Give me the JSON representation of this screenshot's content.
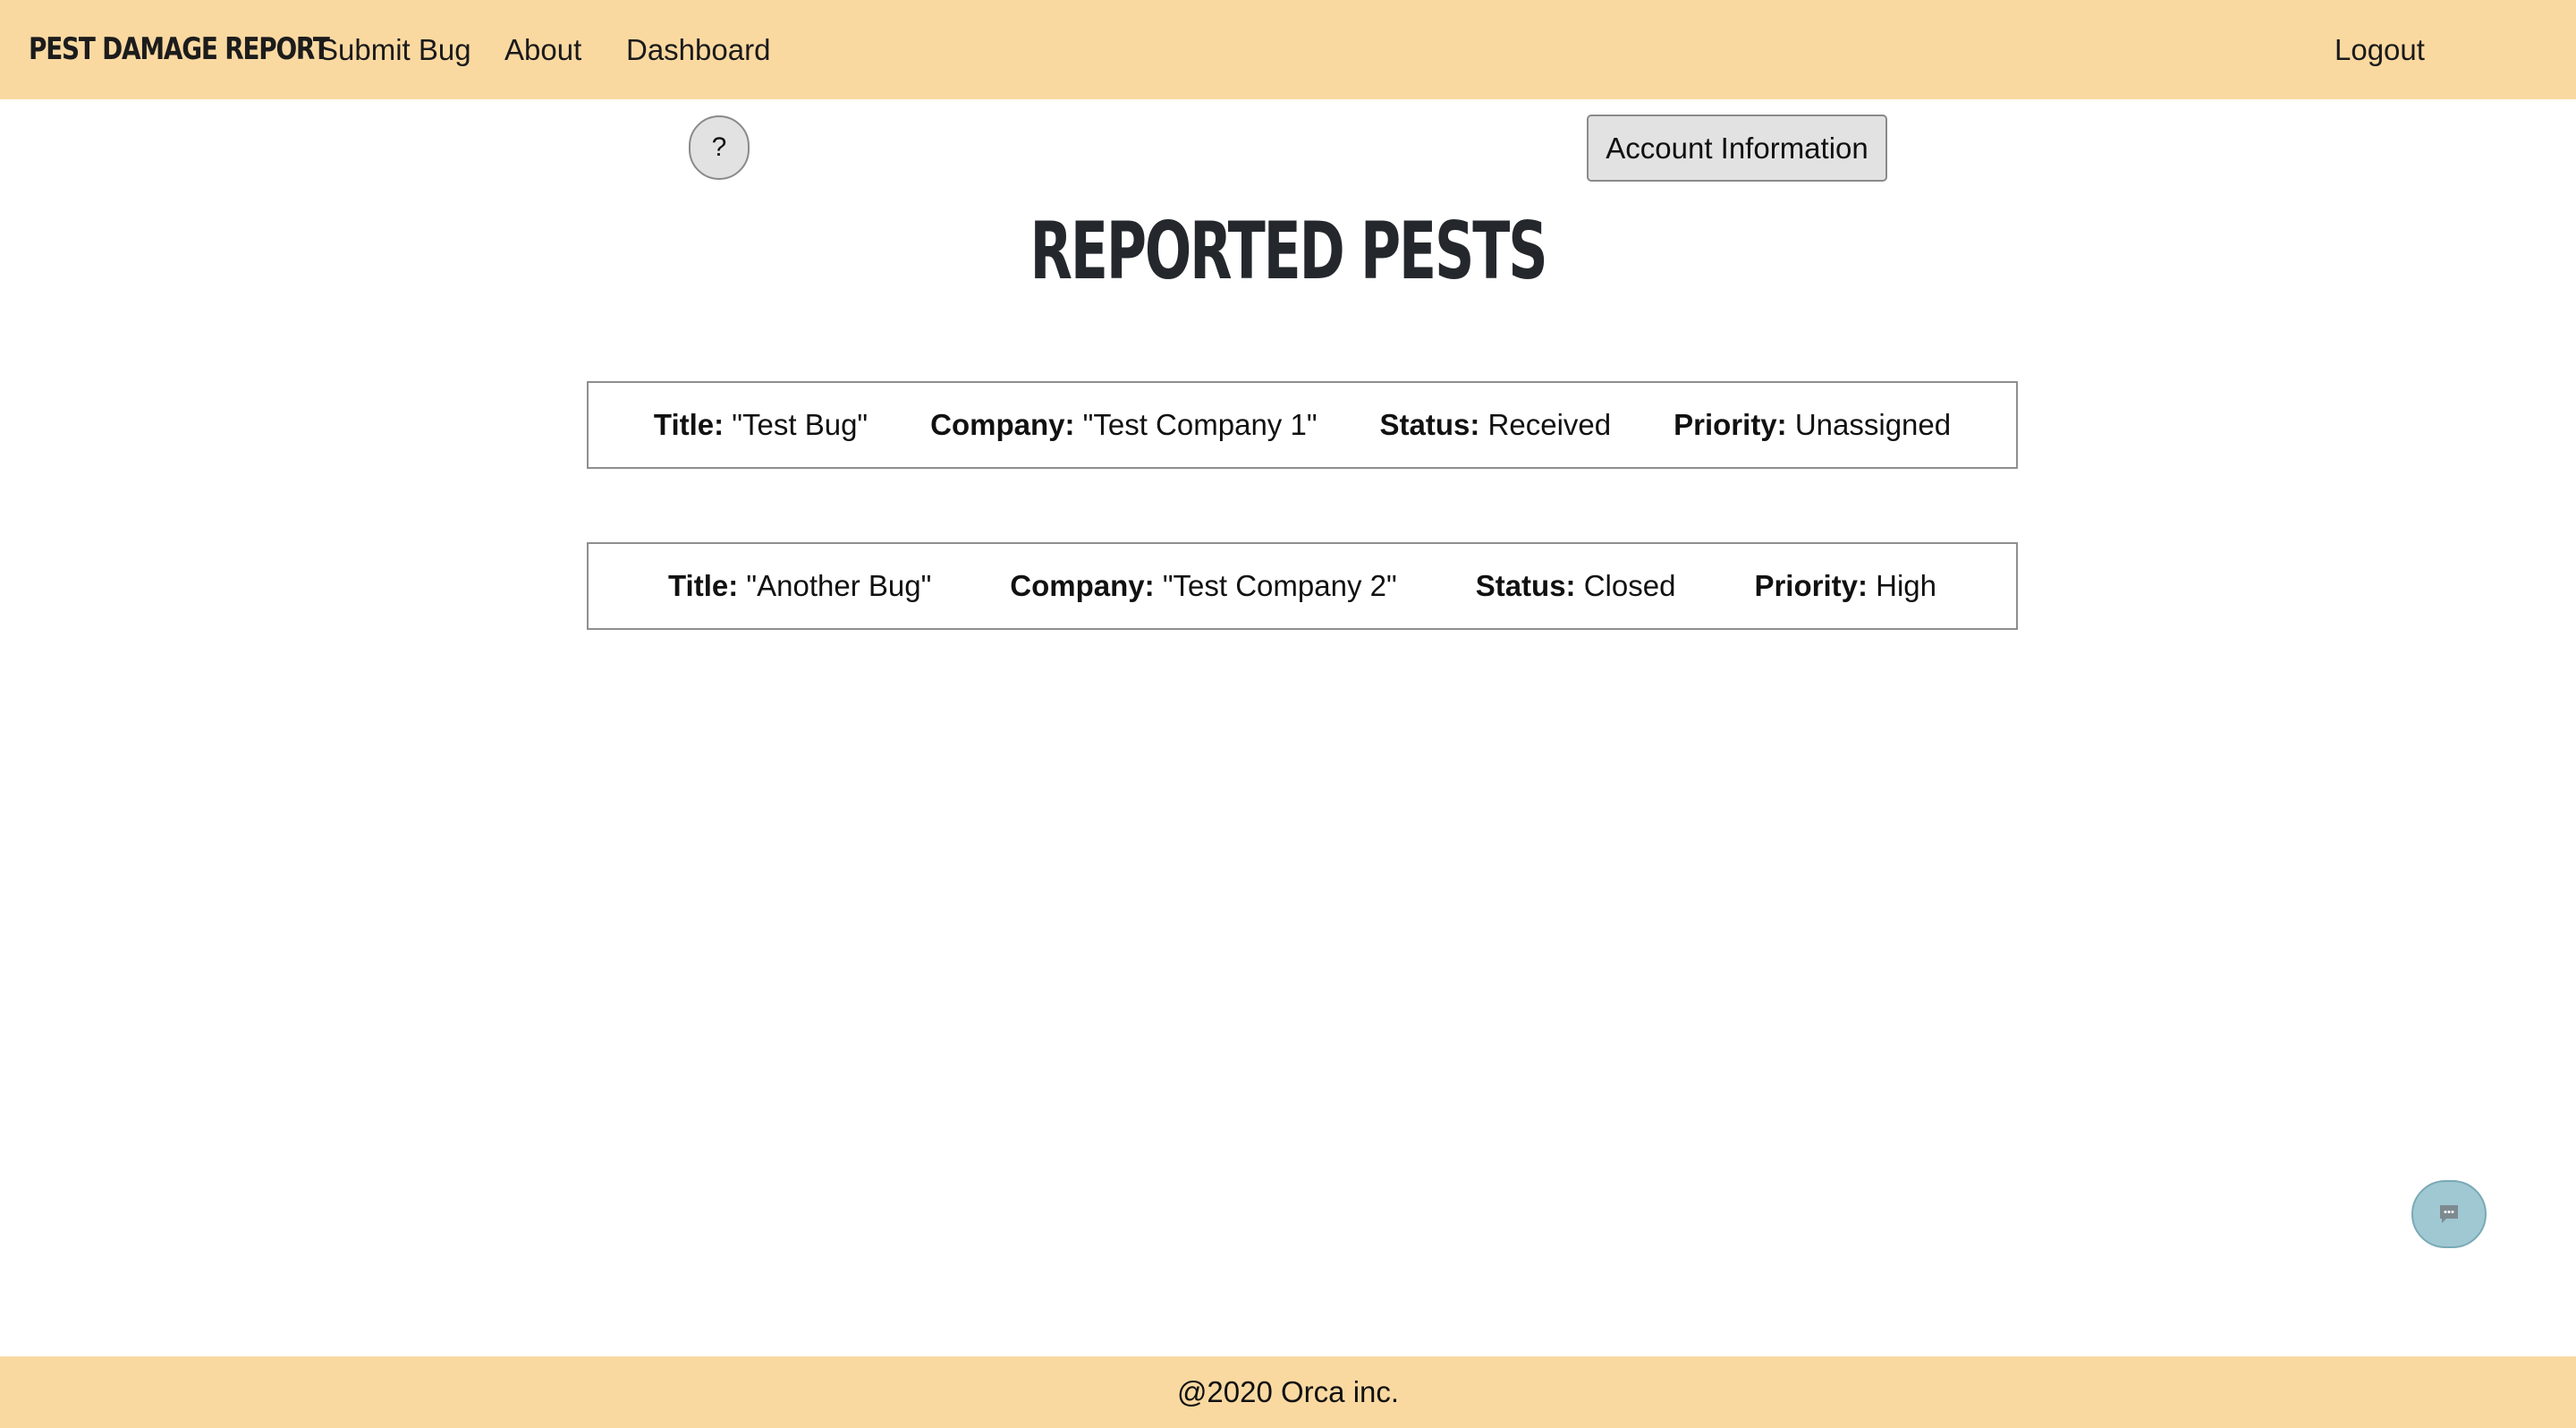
{
  "header": {
    "brand": "PEST DAMAGE REPORT",
    "nav": {
      "submit_bug": "Submit Bug",
      "about": "About",
      "dashboard": "Dashboard"
    },
    "logout": "Logout"
  },
  "controls": {
    "help_label": "?",
    "account_label": "Account Information"
  },
  "page_title": "REPORTED PESTS",
  "bugs": [
    {
      "title_label": "Title:",
      "title": "\"Test Bug\"",
      "company_label": "Company:",
      "company": "\"Test Company 1\"",
      "status_label": "Status:",
      "status": "Received",
      "priority_label": "Priority:",
      "priority": "Unassigned"
    },
    {
      "title_label": "Title:",
      "title": "\"Another Bug\"",
      "company_label": "Company:",
      "company": "\"Test Company 2\"",
      "status_label": "Status:",
      "status": "Closed",
      "priority_label": "Priority:",
      "priority": "High"
    }
  ],
  "chat": {
    "icon": "chat-bubble-icon"
  },
  "footer": {
    "copyright": "@2020 Orca inc."
  },
  "colors": {
    "header_bg": "#FAD9A1",
    "footer_bg": "#FAD9A1",
    "button_bg": "#E2E2E2",
    "chat_bg": "#9FC8D2",
    "title_color": "#24282C"
  }
}
